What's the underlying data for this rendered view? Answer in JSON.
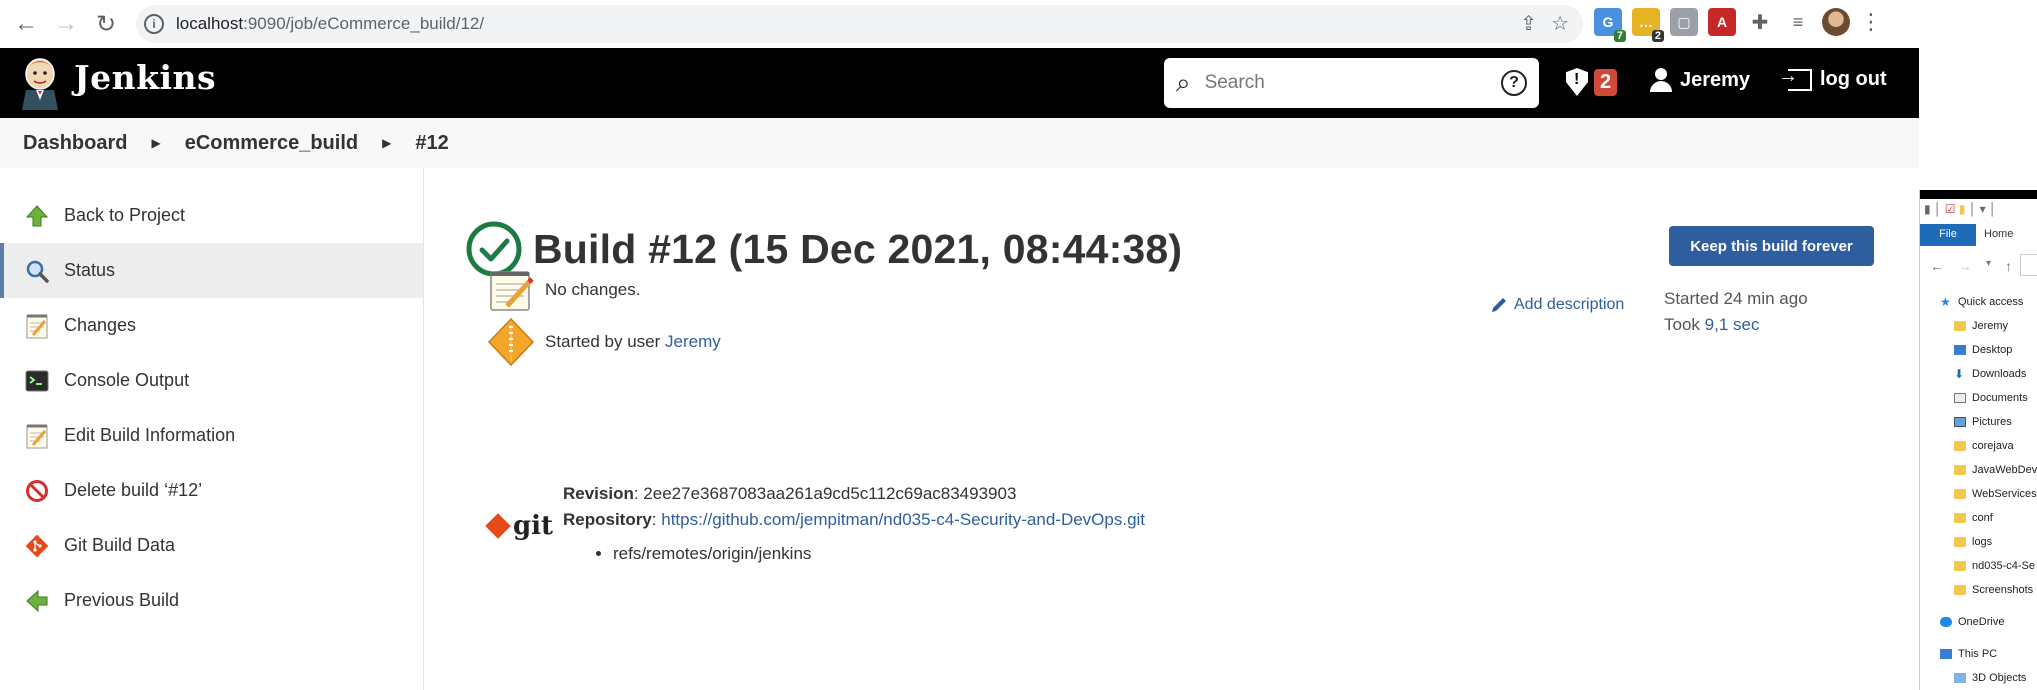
{
  "browser": {
    "url_host": "localhost",
    "url_path": ":9090/job/eCommerce_build/12/",
    "extensions": [
      {
        "name": "extension-blue",
        "badge": "7",
        "color": "#4a8fe0"
      },
      {
        "name": "extension-yellow",
        "badge": "2",
        "color": "#e6b325"
      },
      {
        "name": "extension-gray",
        "badge": "",
        "color": "#9aa0a6"
      },
      {
        "name": "acrobat",
        "badge": "",
        "color": "#c62828"
      }
    ]
  },
  "header": {
    "brand": "Jenkins",
    "search_placeholder": "Search",
    "security_count": "2",
    "user_name": "Jeremy",
    "logout_label": "log out"
  },
  "breadcrumb": {
    "items": [
      "Dashboard",
      "eCommerce_build",
      "#12"
    ]
  },
  "side_tasks": [
    {
      "label": "Back to Project",
      "icon": "up-arrow-icon"
    },
    {
      "label": "Status",
      "icon": "magnifier-icon"
    },
    {
      "label": "Changes",
      "icon": "notepad-icon"
    },
    {
      "label": "Console Output",
      "icon": "terminal-icon"
    },
    {
      "label": "Edit Build Information",
      "icon": "notepad-icon"
    },
    {
      "label": "Delete build ‘#12’",
      "icon": "no-entry-icon"
    },
    {
      "label": "Git Build Data",
      "icon": "git-icon"
    },
    {
      "label": "Previous Build",
      "icon": "left-arrow-icon"
    }
  ],
  "build": {
    "title": "Build #12 (15 Dec 2021, 08:44:38)",
    "keep_label": "Keep this build forever",
    "add_description": "Add description",
    "started_ago": "Started 24 min ago",
    "took_prefix": "Took ",
    "took_value": "9,1 sec",
    "changes_text": "No changes.",
    "started_by_prefix": "Started by user ",
    "started_by_user": "Jeremy",
    "revision_label": "Revision",
    "revision_value": ": 2ee27e3687083aa261a9cd5c112c69ac83493903",
    "repository_label": "Repository",
    "repository_url": "https://github.com/jempitman/nd035-c4-Security-and-DevOps.git",
    "refs": [
      "refs/remotes/origin/jenkins"
    ],
    "git_word": "git"
  },
  "explorer": {
    "tabs": [
      "File",
      "Home"
    ],
    "quick_access": "Quick access",
    "folders": [
      "Jeremy",
      "Desktop",
      "Downloads",
      "Documents",
      "Pictures",
      "corejava",
      "JavaWebDev",
      "WebServices",
      "conf",
      "logs",
      "nd035-c4-Se",
      "Screenshots"
    ],
    "onedrive": "OneDrive",
    "this_pc": "This PC",
    "next_item": "3D Objects"
  }
}
